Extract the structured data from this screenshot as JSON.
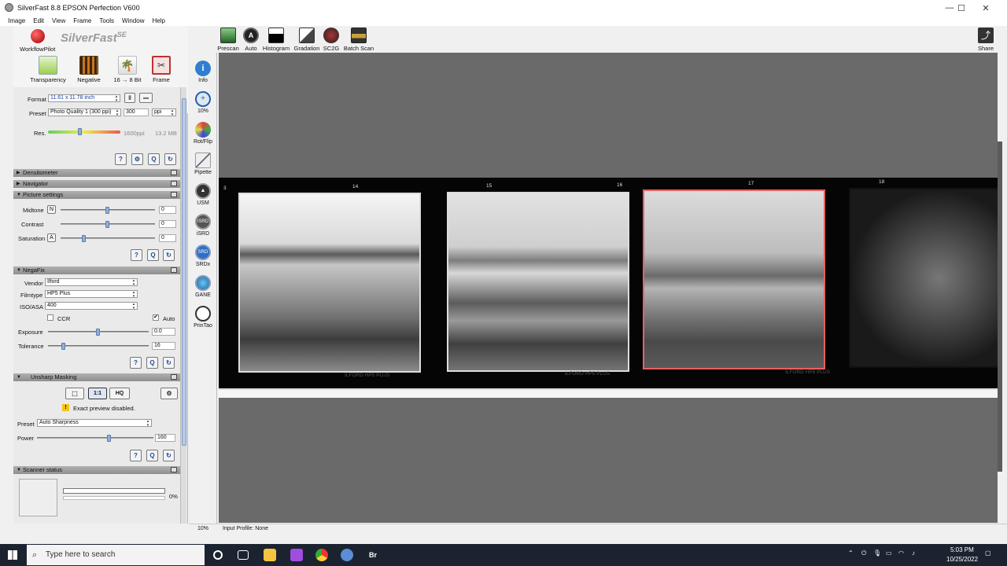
{
  "window": {
    "title": "SilverFast 8.8 EPSON Perfection V600",
    "minimize": "—",
    "maximize": "☐",
    "close": "✕"
  },
  "menu": [
    "Image",
    "Edit",
    "View",
    "Frame",
    "Tools",
    "Window",
    "Help"
  ],
  "logo": {
    "brand": "SilverFast",
    "edition": "SE",
    "workflow_label": "WorkflowPilot"
  },
  "tool_row": [
    {
      "label": "Transparency",
      "icon": "transparency-icon"
    },
    {
      "label": "Negative",
      "icon": "negative-icon"
    },
    {
      "label": "16 → 8 Bit",
      "icon": "bitdepth-icon"
    },
    {
      "label": "Frame",
      "icon": "frame-icon"
    }
  ],
  "frame_settings": {
    "format_label": "Format",
    "format_value": "11.61 x 11.78 inch",
    "preset_label": "Preset",
    "preset_value": "Photo Quality 1 (300 ppi)",
    "ppi_value": "300",
    "ppi_unit": "ppi",
    "res_label": "Res.",
    "res_ppi": "1600ppi",
    "file_size": "13.2 MB",
    "res_level": 0.45
  },
  "sections": {
    "densitometer": "Densitometer",
    "navigator": "Navigator",
    "picture_settings": "Picture settings",
    "negafix": "NegaFix",
    "unsharp": "Unsharp Masking",
    "scanner_status": "Scanner status"
  },
  "picture_settings": [
    {
      "label": "Midtone",
      "mode": "N",
      "value": "0",
      "level": 0.5
    },
    {
      "label": "Contrast",
      "mode": "",
      "value": "0",
      "level": 0.5
    },
    {
      "label": "Saturation",
      "mode": "A",
      "value": "0",
      "level": 0.25
    }
  ],
  "negafix": {
    "vendor_label": "Vendor",
    "vendor_value": "Ilford",
    "filmtype_label": "Filmtype",
    "filmtype_value": "HP5 Plus",
    "iso_label": "ISO/ASA",
    "iso_value": "400",
    "ccr_label": "CCR",
    "auto_label": "Auto",
    "auto_checked": "✔",
    "exposure_label": "Exposure",
    "exposure_value": "0.0",
    "exposure_level": 0.5,
    "tolerance_label": "Tolerance",
    "tolerance_value": "16",
    "tolerance_level": 0.16
  },
  "unsharp": {
    "mode_1to1": "1:1",
    "mode_hq": "HQ",
    "warning": "Exact preview disabled.",
    "preset_label": "Preset",
    "preset_value": "Auto Sharpness",
    "power_label": "Power",
    "power_value": "160",
    "power_level": 0.62
  },
  "scanner_status": {
    "progress_text": "0%",
    "progress": 0
  },
  "side_tools": [
    {
      "label": "Info",
      "icon": "info-icon"
    },
    {
      "label": "10%",
      "icon": "zoom-icon"
    },
    {
      "label": "Rot/Flip",
      "icon": "rotate-flip-icon"
    },
    {
      "label": "Pipette",
      "icon": "pipette-icon"
    },
    {
      "label": "USM",
      "icon": "usm-icon"
    },
    {
      "label": "iSRD",
      "icon": "isrd-icon"
    },
    {
      "label": "SRDx",
      "icon": "srdx-icon"
    },
    {
      "label": "GANE",
      "icon": "gane-icon"
    },
    {
      "label": "PrinTao",
      "icon": "printao-icon"
    }
  ],
  "top_tools": [
    {
      "label": "Prescan",
      "icon": "prescan-icon"
    },
    {
      "label": "Auto",
      "icon": "auto-icon"
    },
    {
      "label": "Histogram",
      "icon": "histogram-icon"
    },
    {
      "label": "Gradation",
      "icon": "gradation-icon"
    },
    {
      "label": "SC2G",
      "icon": "sc2g-icon"
    },
    {
      "label": "Batch Scan",
      "icon": "batch-scan-icon"
    },
    {
      "label": "Share",
      "icon": "share-icon"
    }
  ],
  "film_numbers": [
    "3",
    "14",
    "15",
    "16",
    "17",
    "18"
  ],
  "film_edge_text": [
    "ILFORD HP5 PLUS",
    "ILFORD HP5 PLUS",
    "ILFORD HP5 PLUS"
  ],
  "status_bar": {
    "zoom": "10%",
    "input_profile": "Input Profile: None"
  },
  "taskbar": {
    "search_placeholder": "Type here to search",
    "time": "5:03 PM",
    "date": "10/25/2022",
    "app_br": "Br"
  },
  "colors": {
    "selected_frame": "#e86060",
    "accent": "#1a4c9a"
  }
}
